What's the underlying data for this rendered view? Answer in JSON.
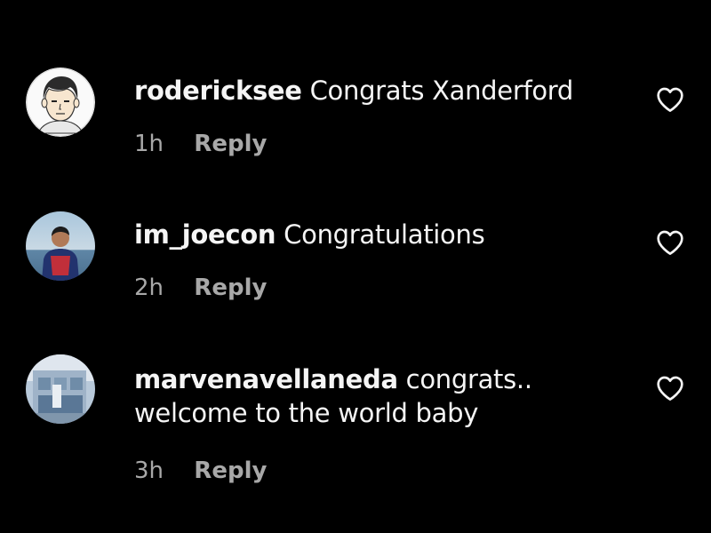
{
  "comments": [
    {
      "username": "rodericksee",
      "text": "Congrats Xanderford",
      "text_line2": "",
      "time": "1h",
      "reply_label": "Reply",
      "avatar_icon": "cartoon-face-avatar",
      "like_icon": "heart-outline-icon"
    },
    {
      "username": "im_joecon",
      "text": "Congratulations",
      "text_line2": "",
      "time": "2h",
      "reply_label": "Reply",
      "avatar_icon": "photo-avatar-person-beach",
      "like_icon": "heart-outline-icon"
    },
    {
      "username": "marvenavellaneda",
      "text": "congrats..",
      "text_line2": "welcome to the world baby",
      "time": "3h",
      "reply_label": "Reply",
      "avatar_icon": "photo-avatar-building",
      "like_icon": "heart-outline-icon"
    }
  ],
  "colors": {
    "background": "#000000",
    "primary_text": "#f5f5f5",
    "secondary_text": "#a8a8a8"
  }
}
